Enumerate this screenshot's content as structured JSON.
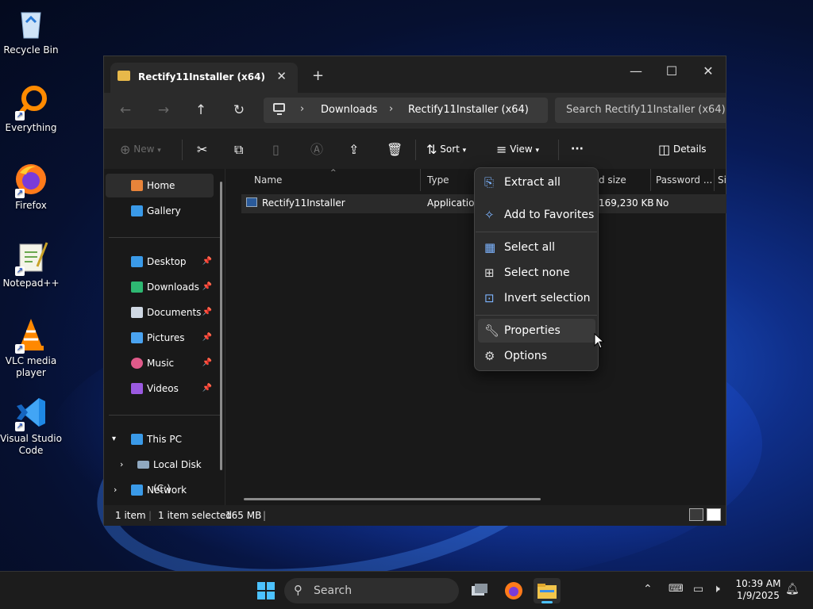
{
  "desktop": {
    "icons": [
      {
        "label": "Recycle Bin",
        "icon": "recycle-bin-icon"
      },
      {
        "label": "Everything",
        "icon": "everything-icon"
      },
      {
        "label": "Firefox",
        "icon": "firefox-icon"
      },
      {
        "label": "Notepad++",
        "icon": "notepadpp-icon"
      },
      {
        "label": "VLC media player",
        "icon": "vlc-icon"
      },
      {
        "label": "Visual Studio Code",
        "icon": "vscode-icon"
      }
    ]
  },
  "window": {
    "tab_title": "Rectify11Installer (x64)",
    "breadcrumb": [
      "Downloads",
      "Rectify11Installer (x64)"
    ],
    "search_placeholder": "Search Rectify11Installer (x64)",
    "commands": {
      "new": "New",
      "sort": "Sort",
      "view": "View",
      "more": "···",
      "details": "Details"
    },
    "sidebar": {
      "top": [
        "Home",
        "Gallery"
      ],
      "pinned": [
        "Desktop",
        "Downloads",
        "Documents",
        "Pictures",
        "Music",
        "Videos"
      ],
      "tree": [
        "This PC",
        "Local Disk (C:)",
        "Network"
      ]
    },
    "columns": [
      "Name",
      "Type",
      "d size",
      "Password ...",
      "Si"
    ],
    "rows": [
      {
        "name": "Rectify11Installer",
        "type": "Application",
        "size": "169,230 KB",
        "password": "No"
      }
    ],
    "status": {
      "items": "1 item",
      "selected": "1 item selected",
      "size": "165 MB"
    }
  },
  "context_menu": {
    "items": [
      {
        "label": "Extract all",
        "icon": "extract-icon"
      },
      {
        "label": "Add to Favorites",
        "icon": "pin-icon"
      },
      {
        "label": "Select all",
        "icon": "select-all-icon"
      },
      {
        "label": "Select none",
        "icon": "select-none-icon"
      },
      {
        "label": "Invert selection",
        "icon": "invert-selection-icon"
      },
      {
        "label": "Properties",
        "icon": "wrench-icon"
      },
      {
        "label": "Options",
        "icon": "gear-icon"
      }
    ]
  },
  "taskbar": {
    "search_label": "Search",
    "time": "10:39 AM",
    "date": "1/9/2025"
  }
}
